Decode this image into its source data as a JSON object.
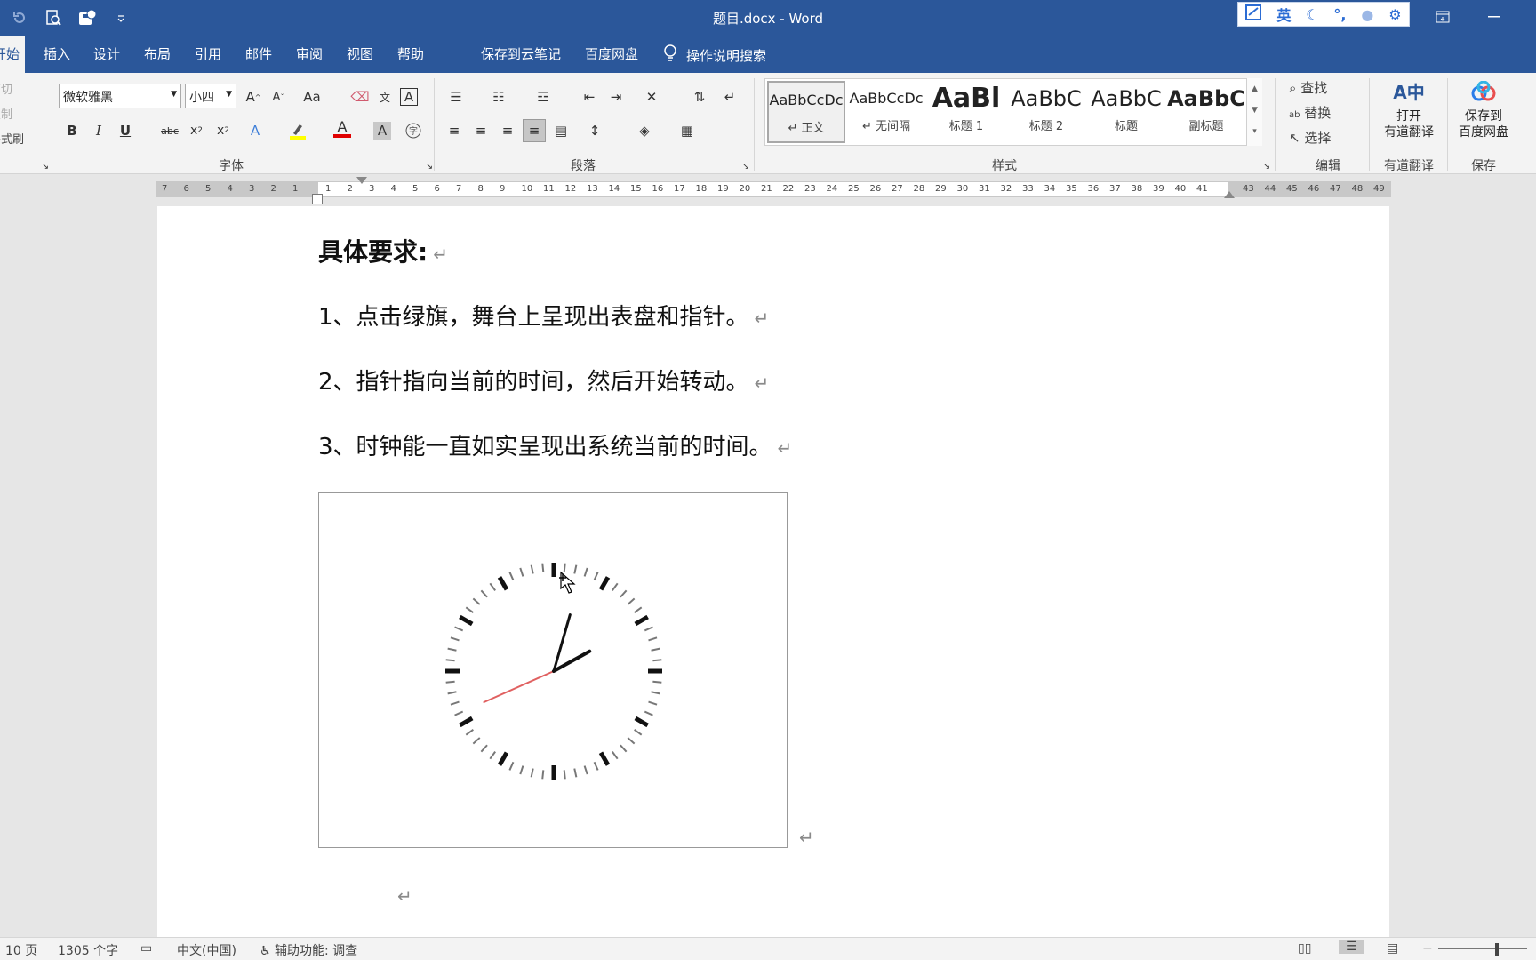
{
  "titlebar": {
    "title": "题目.docx  -  Word"
  },
  "tabs": {
    "items": [
      "开始",
      "插入",
      "设计",
      "布局",
      "引用",
      "邮件",
      "审阅",
      "视图",
      "帮助",
      "保存到云笔记",
      "百度网盘"
    ],
    "search": "操作说明搜索"
  },
  "clipboard": {
    "cut": "剪切",
    "copy": "复制",
    "format_painter": "格式刷"
  },
  "font_group": {
    "font_name": "微软雅黑",
    "font_size": "小四",
    "label": "字体"
  },
  "paragraph_group": {
    "label": "段落"
  },
  "styles_group": {
    "label": "样式",
    "items": [
      {
        "preview": "AaBbCcDc",
        "name": "↵ 正文"
      },
      {
        "preview": "AaBbCcDc",
        "name": "↵ 无间隔"
      },
      {
        "preview": "AaBl",
        "name": "标题 1"
      },
      {
        "preview": "AaBbC",
        "name": "标题 2"
      },
      {
        "preview": "AaBbC",
        "name": "标题"
      },
      {
        "preview": "AaBbC",
        "name": "副标题"
      }
    ]
  },
  "edit_group": {
    "find": "查找",
    "replace": "替换",
    "select": "选择",
    "label": "编辑"
  },
  "youdao_group": {
    "btn": "打开\n有道翻译",
    "label": "有道翻译"
  },
  "save_group": {
    "btn": "保存到\n百度网盘",
    "label": "保存"
  },
  "ruler": {
    "left_ticks": [
      "7",
      "6",
      "5",
      "4",
      "3",
      "2",
      "1"
    ],
    "ticks": [
      "1",
      "2",
      "3",
      "4",
      "5",
      "6",
      "7",
      "8",
      "9",
      "10",
      "11",
      "12",
      "13",
      "14",
      "15",
      "16",
      "17",
      "18",
      "19",
      "20",
      "21",
      "22",
      "23",
      "24",
      "25",
      "26",
      "27",
      "28",
      "29",
      "30",
      "31",
      "32",
      "33",
      "34",
      "35",
      "36",
      "37",
      "38",
      "39",
      "40",
      "41"
    ],
    "right_ticks": [
      "43",
      "44",
      "45",
      "46",
      "47",
      "48",
      "49"
    ]
  },
  "document": {
    "heading": "具体要求:",
    "lines": [
      "1、点击绿旗，舞台上呈现出表盘和指针。",
      "2、指针指向当前的时间，然后开始转动。",
      "3、时钟能一直如实呈现出系统当前的时间。"
    ],
    "pilcrow": "↵"
  },
  "clock": {
    "hour": 2,
    "minute": 2,
    "second": 41,
    "second_hand_color": "#e06060"
  },
  "status": {
    "page": "10 页",
    "words": "1305 个字",
    "language": "中文(中国)",
    "accessibility": "辅助功能: 调查"
  },
  "ime": {
    "mode": "英"
  }
}
